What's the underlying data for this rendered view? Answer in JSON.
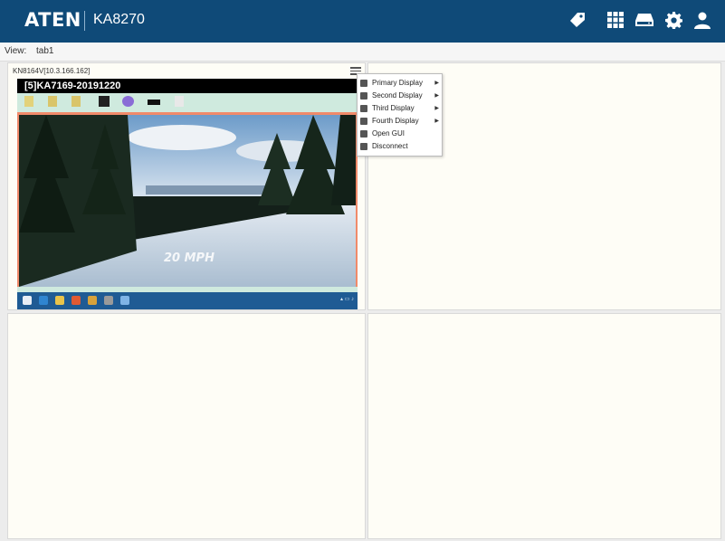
{
  "header": {
    "logo": "ATEN",
    "model": "KA8270",
    "icons": [
      "tag-icon",
      "grid-icon",
      "device-icon",
      "gear-icon",
      "user-icon"
    ]
  },
  "view": {
    "label": "View:",
    "tab": "tab1"
  },
  "panels": [
    {
      "title": "KN8164V[10.3.166.162]",
      "session": {
        "title": "[5]KA7169-20191220",
        "video_overlay": "20 MPH"
      }
    }
  ],
  "context_menu": {
    "items": [
      {
        "label": "Primary Display",
        "has_submenu": true
      },
      {
        "label": "Second Display",
        "has_submenu": true
      },
      {
        "label": "Third Display",
        "has_submenu": true
      },
      {
        "label": "Fourth Display",
        "has_submenu": true
      },
      {
        "label": "Open GUI",
        "has_submenu": false
      },
      {
        "label": "Disconnect",
        "has_submenu": false
      }
    ]
  },
  "colors": {
    "header_bg": "#0f4a78",
    "panel_bg": "#fefdf6",
    "session_border": "#f08a6a",
    "taskbar": "#1f5b94"
  }
}
